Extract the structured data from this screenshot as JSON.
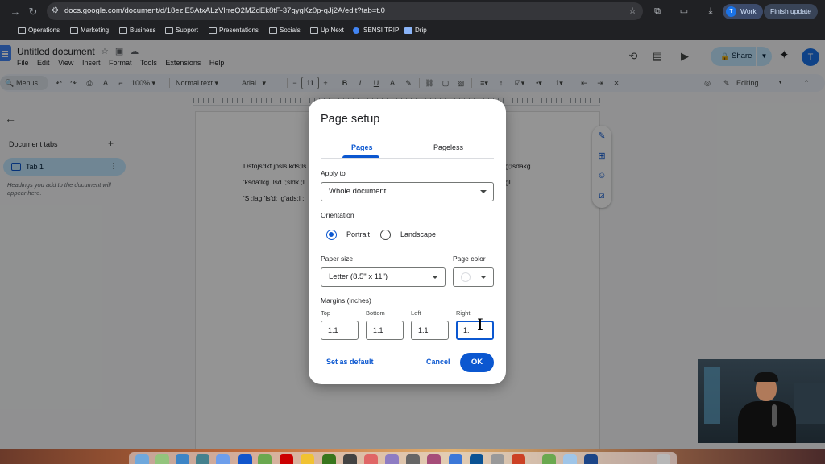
{
  "browser": {
    "url": "docs.google.com/document/d/18eziE5AtxALzVlrreQ2MZdEk8tF-37gygKz0p-qJj2A/edit?tab=t.0",
    "profile_label": "Work",
    "profile_initial": "T",
    "update_label": "Finish update"
  },
  "bookmarks": [
    {
      "label": "Operations",
      "icon": "folder-icon"
    },
    {
      "label": "Marketing",
      "icon": "folder-icon"
    },
    {
      "label": "Business",
      "icon": "folder-icon"
    },
    {
      "label": "Support",
      "icon": "folder-icon"
    },
    {
      "label": "Presentations",
      "icon": "folder-icon"
    },
    {
      "label": "Socials",
      "icon": "folder-icon"
    },
    {
      "label": "Up Next",
      "icon": "folder-icon"
    },
    {
      "label": "SENSI TRIP",
      "icon": "sensi-icon"
    },
    {
      "label": "Drip",
      "icon": "drip-icon"
    }
  ],
  "docs": {
    "title": "Untitled document",
    "menu": [
      "File",
      "Edit",
      "View",
      "Insert",
      "Format",
      "Tools",
      "Extensions",
      "Help"
    ],
    "share_label": "Share",
    "account_initial": "T",
    "menus_search_label": "Menus",
    "zoom": "100%",
    "style": "Normal text",
    "font": "Arial",
    "font_size": "11",
    "mode": "Editing"
  },
  "sidebar": {
    "title": "Document tabs",
    "tab_label": "Tab 1",
    "hint": "Headings you add to the document will appear here."
  },
  "page": {
    "lines": [
      "Dsfojsdkf jpsls kds;ls",
      "'ksda'lkg ;lsd ';sldk ;l",
      "'S ;lag;'ls'd; lg'ads;l ;"
    ],
    "tails": [
      "g;lsdakg",
      "gl"
    ]
  },
  "dialog": {
    "title": "Page setup",
    "tabs": [
      "Pages",
      "Pageless"
    ],
    "apply_to_label": "Apply to",
    "apply_to_value": "Whole document",
    "orientation_label": "Orientation",
    "portrait_label": "Portrait",
    "landscape_label": "Landscape",
    "paper_size_label": "Paper size",
    "paper_size_value": "Letter (8.5\" x 11\")",
    "page_color_label": "Page color",
    "page_color_value": "#ffffff",
    "margins_label": "Margins (inches)",
    "margins": {
      "top_label": "Top",
      "top": "1.1",
      "bottom_label": "Bottom",
      "bottom": "1.1",
      "left_label": "Left",
      "left": "1.1",
      "right_label": "Right",
      "right": "1."
    },
    "set_default_label": "Set as default",
    "cancel_label": "Cancel",
    "ok_label": "OK"
  },
  "colors": {
    "accent": "#0b57d0",
    "share_bg": "#c2e7ff",
    "chrome_bg": "#202124"
  }
}
